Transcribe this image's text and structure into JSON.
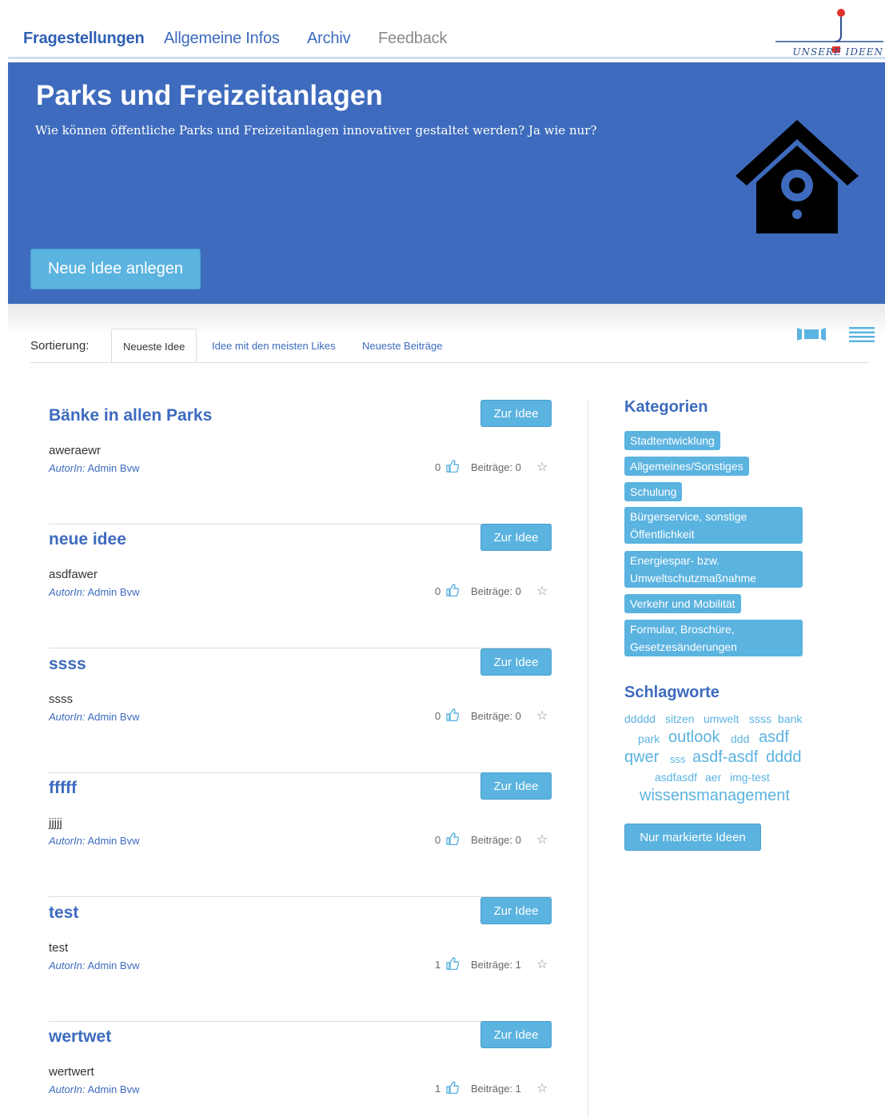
{
  "nav": {
    "items": [
      {
        "label": "Fragestellungen"
      },
      {
        "label": "Allgemeine Infos"
      },
      {
        "label": "Archiv"
      },
      {
        "label": "Feedback"
      }
    ],
    "logo_text": "UNSERE IDEEN"
  },
  "hero": {
    "title": "Parks und Freizeitanlagen",
    "subtitle": "Wie können öffentliche Parks und Freizeitanlagen innovativer gestaltet werden? Ja wie nur?",
    "new_idea_label": "Neue Idee anlegen"
  },
  "sort": {
    "label": "Sortierung:",
    "tabs": [
      {
        "label": "Neueste Idee"
      },
      {
        "label": "Idee mit den meisten Likes"
      },
      {
        "label": "Neueste Beiträge"
      }
    ]
  },
  "ideas": [
    {
      "title": "Bänke in allen Parks",
      "desc": "aweraewr",
      "author_prefix": "AutorIn:",
      "author": "Admin Bvw",
      "likes": "0",
      "beitraege": "Beiträge: 0",
      "button": "Zur Idee"
    },
    {
      "title": "neue idee",
      "desc": "asdfawer",
      "author_prefix": "AutorIn:",
      "author": "Admin Bvw",
      "likes": "0",
      "beitraege": "Beiträge: 0",
      "button": "Zur Idee"
    },
    {
      "title": "ssss",
      "desc": "ssss",
      "author_prefix": "AutorIn:",
      "author": "Admin Bvw",
      "likes": "0",
      "beitraege": "Beiträge: 0",
      "button": "Zur Idee"
    },
    {
      "title": "fffff",
      "desc": "jjjjj",
      "author_prefix": "AutorIn:",
      "author": "Admin Bvw",
      "likes": "0",
      "beitraege": "Beiträge: 0",
      "button": "Zur Idee"
    },
    {
      "title": "test",
      "desc": "test",
      "author_prefix": "AutorIn:",
      "author": "Admin Bvw",
      "likes": "1",
      "beitraege": "Beiträge: 1",
      "button": "Zur Idee"
    },
    {
      "title": "wertwet",
      "desc": "wertwert",
      "author_prefix": "AutorIn:",
      "author": "Admin Bvw",
      "likes": "1",
      "beitraege": "Beiträge: 1",
      "button": "Zur Idee"
    }
  ],
  "sidebar": {
    "categories_title": "Kategorien",
    "categories": [
      "Stadtentwicklung",
      "Allgemeines/Sonstiges",
      "Schulung",
      "Bürgerservice, sonstige Öffentlichkeit",
      "Energiespar- bzw. Umweltschutzmaßnahme",
      "Verkehr und Mobilität",
      "Formular, Broschüre, Gesetzesänderungen"
    ],
    "tags_title": "Schlagworte",
    "tags": [
      "ddddd",
      "sitzen",
      "umwelt",
      "ssss",
      "bank",
      "park",
      "outlook",
      "ddd",
      "asdf",
      "qwer",
      "sss",
      "asdf-asdf",
      "dddd",
      "asdfasdf",
      "aer",
      "img-test",
      "wissensmanagement"
    ],
    "marked_label": "Nur markierte Ideen"
  },
  "icons": {
    "thumb": "thumbs-up-icon",
    "star": "star-icon",
    "birdhouse": "birdhouse-icon",
    "view_tiles": "tile-view-icon",
    "view_list": "list-view-icon"
  },
  "colors": {
    "primary": "#3e6bbd",
    "accent": "#5bb3e0",
    "link": "#3d6bbf"
  }
}
